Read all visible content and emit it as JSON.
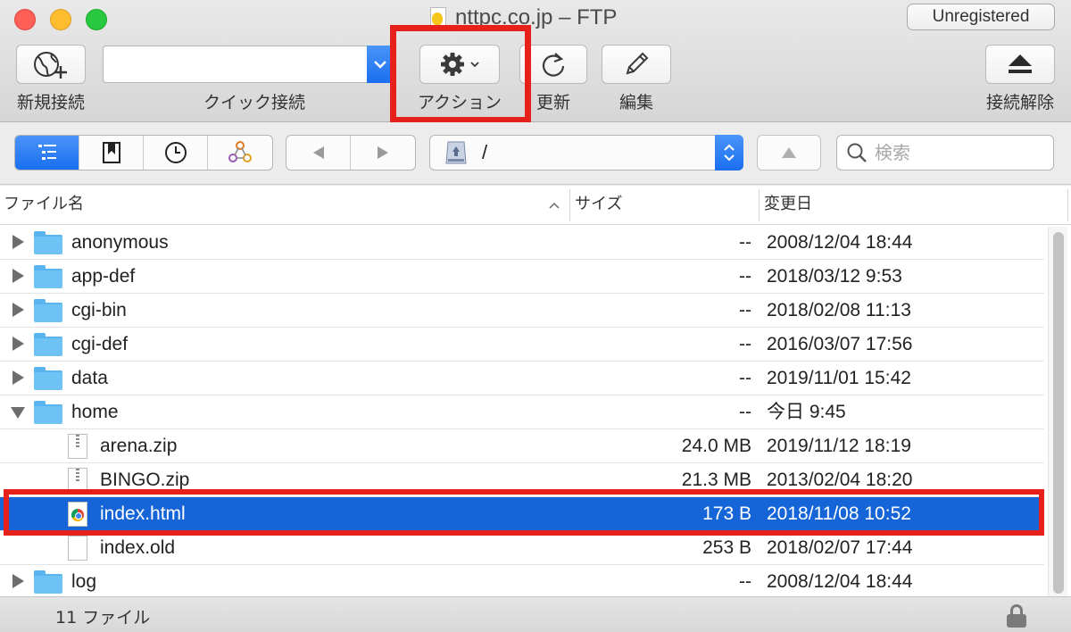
{
  "window": {
    "title": "nttpc.co.jp – FTP",
    "badge": "Unregistered"
  },
  "toolbar": {
    "new_connection": "新規接続",
    "quick_connect": "クイック接続",
    "quick_connect_value": "",
    "action": "アクション",
    "refresh": "更新",
    "edit": "編集",
    "disconnect": "接続解除"
  },
  "nav": {
    "path": "/",
    "search_placeholder": "検索"
  },
  "columns": {
    "name": "ファイル名",
    "size": "サイズ",
    "modified": "変更日"
  },
  "files": [
    {
      "name": "anonymous",
      "size": "--",
      "date": "2008/12/04 18:44",
      "kind": "folder",
      "expanded": false
    },
    {
      "name": "app-def",
      "size": "--",
      "date": "2018/03/12 9:53",
      "kind": "folder",
      "expanded": false
    },
    {
      "name": "cgi-bin",
      "size": "--",
      "date": "2018/02/08 11:13",
      "kind": "folder",
      "expanded": false
    },
    {
      "name": "cgi-def",
      "size": "--",
      "date": "2016/03/07 17:56",
      "kind": "folder",
      "expanded": false
    },
    {
      "name": "data",
      "size": "--",
      "date": "2019/11/01 15:42",
      "kind": "folder",
      "expanded": false
    },
    {
      "name": "home",
      "size": "--",
      "date": "今日 9:45",
      "kind": "folder",
      "expanded": true
    },
    {
      "name": "arena.zip",
      "size": "24.0 MB",
      "date": "2019/11/12 18:19",
      "kind": "zip"
    },
    {
      "name": "BINGO.zip",
      "size": "21.3 MB",
      "date": "2013/02/04 18:20",
      "kind": "zip"
    },
    {
      "name": "index.html",
      "size": "173 B",
      "date": "2018/11/08 10:52",
      "kind": "html",
      "selected": true
    },
    {
      "name": "index.old",
      "size": "253 B",
      "date": "2018/02/07 17:44",
      "kind": "doc"
    },
    {
      "name": "log",
      "size": "--",
      "date": "2008/12/04 18:44",
      "kind": "folder",
      "expanded": false
    }
  ],
  "status": {
    "count": "11 ファイル"
  },
  "colors": {
    "accent": "#1a6ef0",
    "selection": "#1565d8",
    "highlight_annotation": "#e8201b"
  }
}
